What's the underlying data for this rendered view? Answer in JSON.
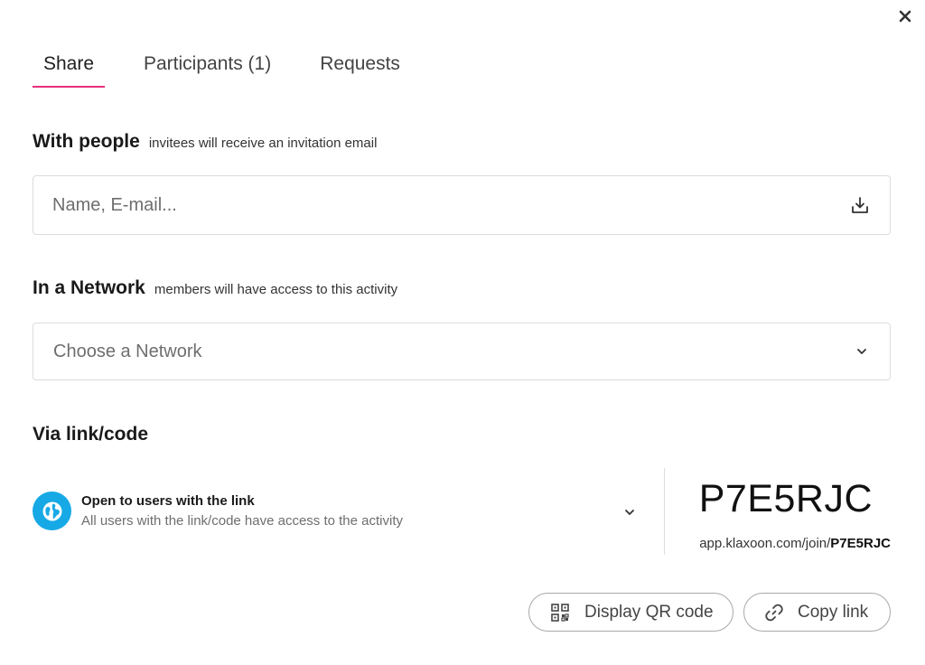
{
  "tabs": [
    {
      "label": "Share"
    },
    {
      "label": "Participants (1)"
    },
    {
      "label": "Requests"
    }
  ],
  "with_people": {
    "title": "With people",
    "hint": "invitees will receive an invitation email",
    "placeholder": "Name, E-mail..."
  },
  "network": {
    "title": "In a Network",
    "hint": "members will have access to this activity",
    "placeholder": "Choose a Network"
  },
  "via_link": {
    "title": "Via link/code",
    "access_title": "Open to users with the link",
    "access_desc": "All users with the link/code have access to the activity",
    "code": "P7E5RJC",
    "url_prefix": "app.klaxoon.com/join/",
    "url_code": "P7E5RJC"
  },
  "buttons": {
    "qr_label": "Display QR code",
    "copy_label": "Copy link"
  },
  "colors": {
    "accent": "#e6307a",
    "globe": "#17a9e6"
  },
  "icons": [
    "close-icon",
    "import-icon",
    "chevron-down-icon",
    "globe-icon",
    "qr-code-icon",
    "link-icon"
  ]
}
